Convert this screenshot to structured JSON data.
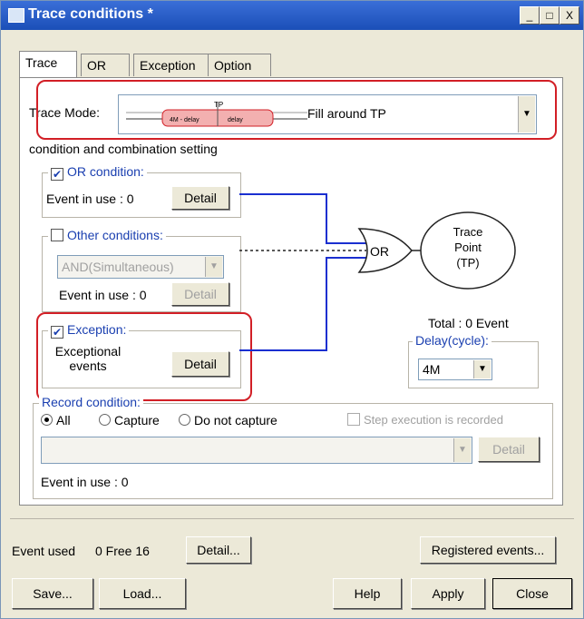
{
  "window": {
    "title": "Trace conditions *",
    "min_label": "_",
    "max_label": "□",
    "close_label": "X"
  },
  "tabs": [
    "Trace",
    "OR",
    "Exception",
    "Option"
  ],
  "trace_mode": {
    "label": "Trace Mode:",
    "value": "Fill around TP",
    "diagram": {
      "tp": "TP",
      "left": "4M - delay",
      "right": "delay"
    }
  },
  "section_heading": "condition and combination setting",
  "or_condition": {
    "legend": "OR condition:",
    "checked": true,
    "event_text": "Event in use :  0",
    "detail": "Detail"
  },
  "other_conditions": {
    "legend": "Other conditions:",
    "checked": false,
    "select_value": "AND(Simultaneous)",
    "event_text": "Event in use : 0",
    "detail": "Detail"
  },
  "exception": {
    "legend": "Exception:",
    "checked": true,
    "text_line1": "Exceptional",
    "text_line2": "events",
    "detail": "Detail"
  },
  "gate": {
    "label": "OR"
  },
  "trace_point": {
    "line1": "Trace",
    "line2": "Point",
    "line3": "(TP)"
  },
  "total_text": "Total : 0  Event",
  "delay": {
    "legend": "Delay(cycle):",
    "value": "4M"
  },
  "record": {
    "legend": "Record condition:",
    "options": [
      "All",
      "Capture",
      "Do not capture"
    ],
    "selected": "All",
    "step_label": "Step execution is recorded",
    "detail": "Detail",
    "event_text": "Event in use : 0"
  },
  "footer": {
    "event_used": "Event used",
    "counts": "0  Free 16",
    "detail_btn": "Detail...",
    "registered_btn": "Registered events...",
    "save_btn": "Save...",
    "load_btn": "Load...",
    "help_btn": "Help",
    "apply_btn": "Apply",
    "close_btn": "Close"
  },
  "colors": {
    "highlight": "#d21f26",
    "wire": "#1a2fd0",
    "accent_blue": "#1a3fb0"
  }
}
